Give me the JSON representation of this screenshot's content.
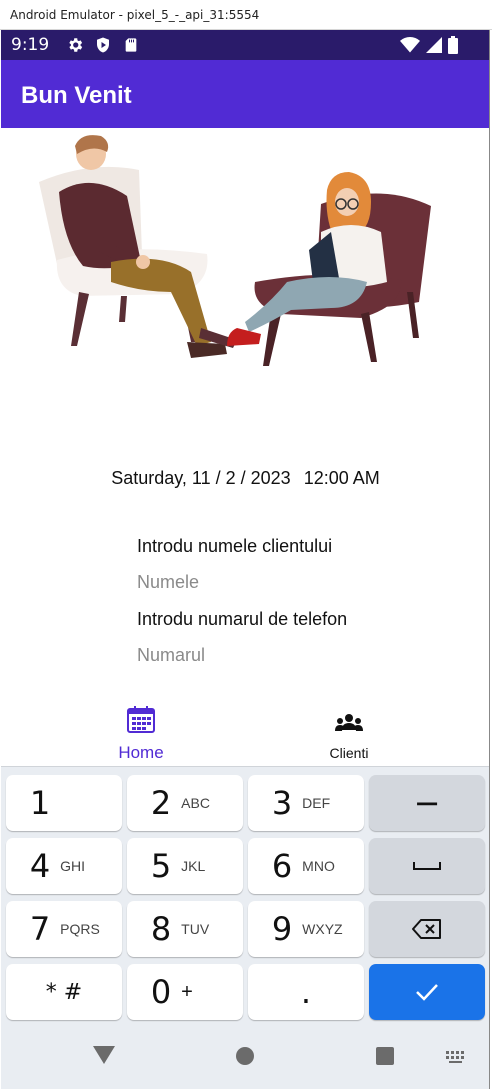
{
  "window": {
    "title": "Android Emulator - pixel_5_-_api_31:5554"
  },
  "status_bar": {
    "time": "9:19",
    "left_icons": [
      "settings-gear-icon",
      "shield-play-icon",
      "sd-card-icon"
    ],
    "right_icons": [
      "wifi-icon",
      "signal-icon",
      "battery-icon"
    ]
  },
  "app_bar": {
    "title": "Bun Venit",
    "color": "#512bd4"
  },
  "illustration": {
    "name": "therapy-session-illustration"
  },
  "datetime": {
    "date": "Saturday, 11 / 2 / 2023",
    "time": "12:00 AM"
  },
  "form": {
    "name_label": "Introdu numele clientului",
    "name_placeholder": "Numele",
    "phone_label": "Introdu numarul de telefon",
    "phone_placeholder": "Numarul"
  },
  "tabs": [
    {
      "label": "Home",
      "icon": "calendar-icon",
      "active": true
    },
    {
      "label": "Clienti",
      "icon": "people-group-icon",
      "active": false
    }
  ],
  "keyboard": {
    "rows": [
      [
        {
          "digit": "1",
          "letters": ""
        },
        {
          "digit": "2",
          "letters": "ABC"
        },
        {
          "digit": "3",
          "letters": "DEF"
        },
        {
          "digit": "−",
          "letters": ""
        }
      ],
      [
        {
          "digit": "4",
          "letters": "GHI"
        },
        {
          "digit": "5",
          "letters": "JKL"
        },
        {
          "digit": "6",
          "letters": "MNO"
        },
        {
          "digit": "",
          "letters": ""
        }
      ],
      [
        {
          "digit": "7",
          "letters": "PQRS"
        },
        {
          "digit": "8",
          "letters": "TUV"
        },
        {
          "digit": "9",
          "letters": "WXYZ"
        },
        {
          "digit": "",
          "letters": ""
        }
      ],
      [
        {
          "digit": "* #",
          "letters": ""
        },
        {
          "digit": "0",
          "letters": "+"
        },
        {
          "digit": ".",
          "letters": ""
        },
        {
          "digit": "",
          "letters": ""
        }
      ]
    ],
    "special_keys": [
      "minus-key",
      "space-key",
      "backspace-icon",
      "checkmark-icon"
    ],
    "accent": "#1a73e8"
  },
  "nav_bar": {
    "buttons": [
      "back-triangle-icon",
      "home-circle-icon",
      "recents-square-icon",
      "keyboard-switch-icon"
    ]
  }
}
